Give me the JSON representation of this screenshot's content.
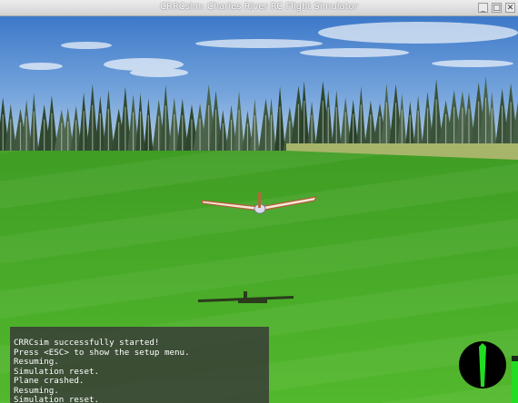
{
  "window": {
    "title": "CRRCsim: Charles River RC Flight Simulator",
    "buttons": {
      "minimize": "_",
      "maximize": "□",
      "close": "✕"
    }
  },
  "console": {
    "lines": [
      "CRRCsim successfully started!",
      "Press <ESC> to show the setup menu.",
      "Resuming.",
      "Simulation reset.",
      "Plane crashed.",
      "Resuming.",
      "Simulation reset."
    ]
  },
  "hud": {
    "throttle_level": 0.9,
    "colors": {
      "throttle": "#22dd22",
      "compass_needle": "#22dd22"
    }
  }
}
